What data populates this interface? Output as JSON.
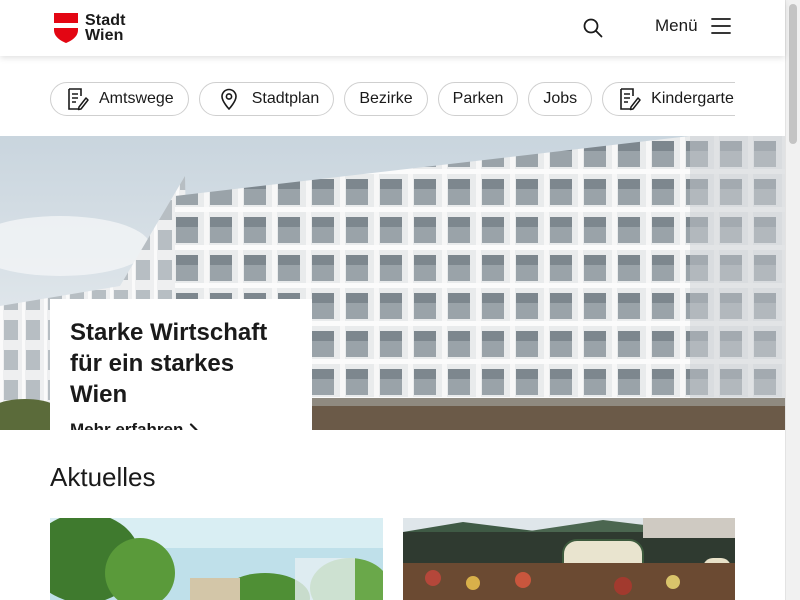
{
  "brand": {
    "name_line1": "Stadt",
    "name_line2": "Wien",
    "shield_color": "#e30613"
  },
  "header": {
    "search_icon": "search-icon",
    "menu_label": "Menü",
    "menu_icon": "hamburger-icon"
  },
  "quicklinks": [
    {
      "label": "Amtswege",
      "icon": "document-pen-icon"
    },
    {
      "label": "Stadtplan",
      "icon": "map-pin-icon"
    },
    {
      "label": "Bezirke",
      "icon": ""
    },
    {
      "label": "Parken",
      "icon": ""
    },
    {
      "label": "Jobs",
      "icon": ""
    },
    {
      "label": "Kindergarten",
      "icon": "document-pen-icon"
    }
  ],
  "hero": {
    "title_line1": "Starke Wirtschaft",
    "title_line2": "für ein starkes Wien",
    "link_label": "Mehr erfahren",
    "link_icon": "chevron-right-icon"
  },
  "news": {
    "section_title": "Aktuelles"
  }
}
